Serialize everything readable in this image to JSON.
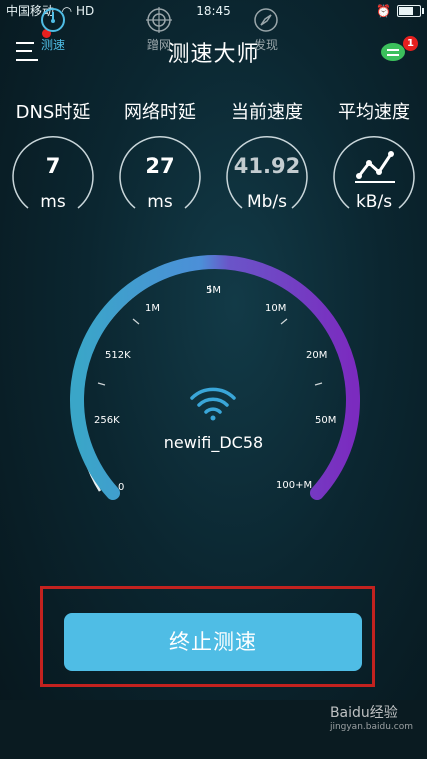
{
  "status": {
    "carrier": "中国移动",
    "time": "18:45",
    "network": "HD"
  },
  "header": {
    "title": "测速大师",
    "message_count": "1"
  },
  "metrics": [
    {
      "label": "DNS时延",
      "value": "7",
      "unit": "ms"
    },
    {
      "label": "网络时延",
      "value": "27",
      "unit": "ms"
    },
    {
      "label": "当前速度",
      "value": "41.92",
      "unit": "Mb/s"
    },
    {
      "label": "平均速度",
      "icon": "line-chart-icon",
      "unit": "kB/s"
    }
  ],
  "gauge": {
    "ticks": [
      "0",
      "256K",
      "512K",
      "1M",
      "5M",
      "10M",
      "20M",
      "50M",
      "100+M"
    ],
    "wifi_name": "newifi_DC58",
    "needle_label": "5M"
  },
  "actions": {
    "stop_label": "终止测速"
  },
  "nav": [
    {
      "label": "测速",
      "icon": "speedometer-icon",
      "active": true
    },
    {
      "label": "蹭网",
      "icon": "target-icon",
      "active": false
    },
    {
      "label": "发现",
      "icon": "compass-icon",
      "active": false
    }
  ],
  "watermark": {
    "text": "Baidu经验",
    "sub": "jingyan.baidu.com"
  },
  "colors": {
    "accent": "#4fbde5",
    "purple": "#7b2bbf",
    "badge": "#e6201f",
    "frame": "#c3221f"
  }
}
